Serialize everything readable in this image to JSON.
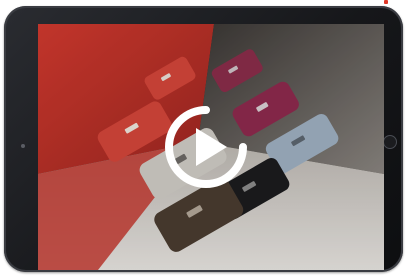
{
  "video": {
    "icon": "play-icon",
    "state": "paused",
    "subject": "product-hero",
    "colors": {
      "red_backdrop": "#c8342c",
      "gray_backdrop": "#6e6a66",
      "floor": "#d9d6d2",
      "play_ring": "#ffffff",
      "accent": "#e0392a"
    }
  },
  "device": {
    "frame_color": "#1b1c1f",
    "home_button_icon": "home-button-icon",
    "camera_icon": "camera-icon"
  }
}
